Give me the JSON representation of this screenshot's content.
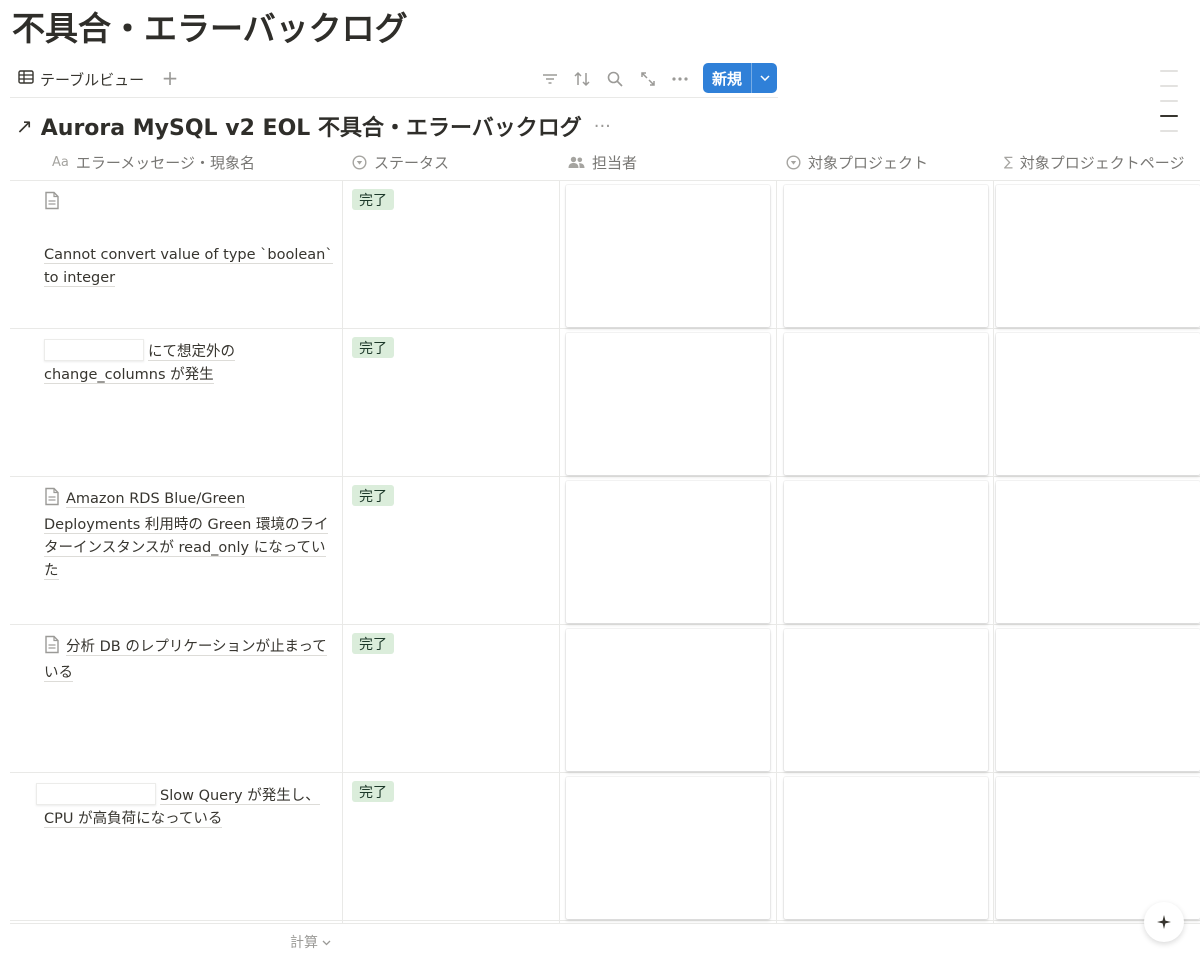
{
  "page": {
    "title": "不具合・エラーバックログ"
  },
  "view_bar": {
    "tab_label": "テーブルビュー",
    "tab_icon": "table-icon",
    "add_view": "+",
    "tools": [
      "filter-icon",
      "sort-icon",
      "search-icon",
      "expand-icon",
      "more-icon"
    ],
    "new_button": "新規"
  },
  "database": {
    "arrow": "↗",
    "title": "Aurora MySQL v2 EOL 不具合・エラーバックログ",
    "more": "···"
  },
  "columns": [
    {
      "label": "エラーメッセージ・現象名",
      "icon": "Aa"
    },
    {
      "label": "ステータス",
      "icon": "status-icon"
    },
    {
      "label": "担当者",
      "icon": "people-icon"
    },
    {
      "label": "対象プロジェクト",
      "icon": "status-icon"
    },
    {
      "label": "対象プロジェクトページ",
      "icon": "∑"
    }
  ],
  "rows": [
    {
      "name": "Cannot convert value of type `boolean` to integer",
      "status": "完了"
    },
    {
      "name": "にて想定外の change_columns が発生",
      "status": "完了"
    },
    {
      "name": "Amazon RDS Blue/Green Deployments 利用時の Green 環境のライターインスタンスが read_only になっていた",
      "status": "完了"
    },
    {
      "name": "分析 DB のレプリケーションが止まっている",
      "status": "完了"
    },
    {
      "name": "Slow Query が発生し、CPU が高負荷になっている",
      "status": "完了"
    }
  ],
  "footer": {
    "calc_label": "計算"
  },
  "colors": {
    "accent": "#2f80d8",
    "status_bg": "#dbeddb",
    "status_text": "#1c3829"
  }
}
